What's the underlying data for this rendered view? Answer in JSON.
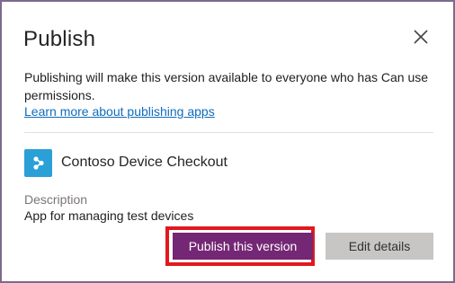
{
  "dialog": {
    "title": "Publish",
    "close_icon": "close-icon",
    "description": "Publishing will make this version available to everyone who has Can use permissions.",
    "learn_more_link": "Learn more about publishing apps"
  },
  "app": {
    "icon": "app-tile-icon",
    "name": "Contoso Device Checkout"
  },
  "details": {
    "description_label": "Description",
    "description_value": "App for managing test devices"
  },
  "actions": {
    "publish_label": "Publish this version",
    "edit_label": "Edit details"
  },
  "colors": {
    "primary": "#742774",
    "link": "#0f6cbd",
    "app_icon": "#2aa0d7",
    "highlight": "#e1191e",
    "secondary_button": "#c8c6c4"
  }
}
